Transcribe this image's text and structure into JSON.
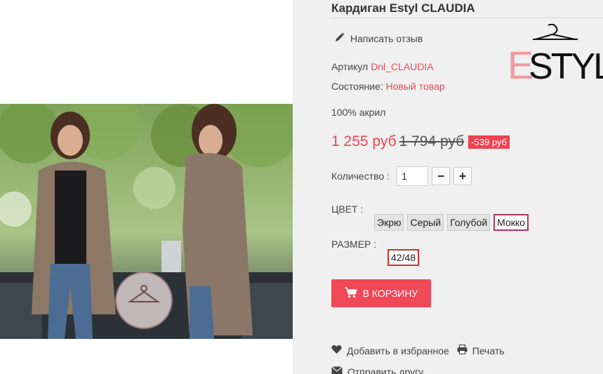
{
  "product": {
    "title": "Кардиган Estyl CLAUDIA",
    "review_link": "Написать отзыв",
    "article_label": "Артикул",
    "article_value": "Dnl_CLAUDIA",
    "state_label": "Состояние:",
    "state_value": "Новый товар",
    "description": "100% акрил",
    "brand_logo_text": "ESTYL"
  },
  "price": {
    "current": "1 255 руб",
    "old": "1 794 руб",
    "discount": "-539 руб"
  },
  "quantity": {
    "label": "Количество :",
    "value": "1",
    "minus": "−",
    "plus": "+"
  },
  "options": {
    "color_label": "ЦВЕТ :",
    "colors": [
      "Экрю",
      "Серый",
      "Голубой",
      "Мокко"
    ],
    "selected_color": "Мокко",
    "size_label": "РАЗМЕР :",
    "sizes": [
      "42/48"
    ],
    "selected_size": "42/48"
  },
  "actions": {
    "add_to_cart": "В КОРЗИНУ",
    "favorite": "Добавить в избранное",
    "print": "Печать",
    "send_friend": "Отправить другу"
  },
  "icons": {
    "review": "pencil-icon",
    "cart": "cart-icon",
    "favorite": "heart-icon",
    "print": "printer-icon",
    "send": "envelope-icon"
  },
  "colors": {
    "accent": "#ef4857",
    "discount_bg": "#ef4250",
    "link": "#e84b57",
    "selected_color_border": "#b0355d",
    "selected_size_border": "#d52d2d",
    "panel_bg": "#f0f0f0"
  }
}
